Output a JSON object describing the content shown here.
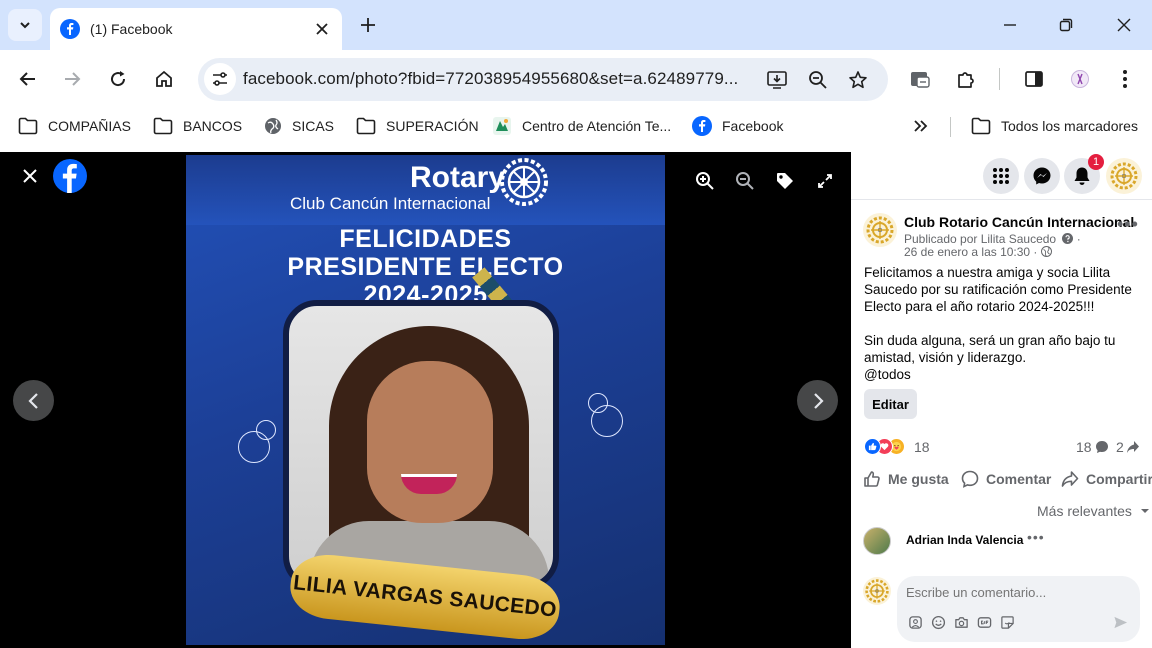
{
  "browser": {
    "tab_title": "(1) Facebook",
    "url": "facebook.com/photo?fbid=772038954955680&set=a.62489779...",
    "bookmarks": [
      {
        "label": "COMPAÑIAS",
        "icon": "folder-icon"
      },
      {
        "label": "BANCOS",
        "icon": "folder-icon"
      },
      {
        "label": "SICAS",
        "icon": "globe-icon"
      },
      {
        "label": "SUPERACIÓN",
        "icon": "folder-icon"
      },
      {
        "label": "Centro de Atención Te...",
        "icon": "site-icon"
      },
      {
        "label": "Facebook",
        "icon": "facebook-icon"
      }
    ],
    "all_bookmarks": "Todos los marcadores"
  },
  "photo": {
    "brand": "Rotary",
    "club": "Club Cancún Internacional",
    "headline_1": "FELICIDADES",
    "headline_2": "PRESIDENTE ELECTO",
    "headline_3": "2024-2025",
    "name_ribbon": "LILIA VARGAS SAUCEDO"
  },
  "panel": {
    "notification_count": "1",
    "post": {
      "author": "Club Rotario Cancún Internacional",
      "published_by": "Publicado por Lilita Saucedo",
      "date": "26 de enero a las 10:30 ·",
      "text_1": "Felicitamos a nuestra amiga y socia Lilita Saucedo por su ratificación como Presidente Electo para el año rotario 2024-2025!!!",
      "text_2": "Sin duda alguna, será un gran año bajo tu amistad, visión y liderazgo.",
      "text_3": "@todos",
      "edit_label": "Editar"
    },
    "stats": {
      "reaction_count": "18",
      "comment_count": "18",
      "share_count": "2"
    },
    "actions": {
      "like": "Me gusta",
      "comment": "Comentar",
      "share": "Compartir"
    },
    "sort_label": "Más relevantes",
    "comments": [
      {
        "author": "Adrian Inda Valencia"
      }
    ],
    "composer_placeholder": "Escribe un comentario..."
  },
  "colors": {
    "facebook_blue": "#0866ff",
    "chrome_tab_strip": "#d3e3fd",
    "omnibox": "#e9eef6",
    "notification_red": "#e41e3f"
  }
}
